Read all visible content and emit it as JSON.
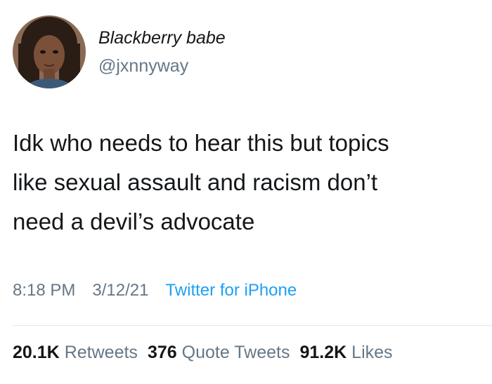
{
  "user": {
    "display_name": "Blackberry babe",
    "handle": "@jxnnyway"
  },
  "tweet": {
    "lines": [
      "Idk who needs to hear this but topics",
      "like sexual assault and racism don’t",
      "need a devil’s advocate"
    ],
    "time": "8:18 PM",
    "date": "3/12/21",
    "source": "Twitter for iPhone"
  },
  "stats": {
    "retweets_count": "20.1K",
    "retweets_label": "Retweets",
    "quotes_count": "376",
    "quotes_label": "Quote Tweets",
    "likes_count": "91.2K",
    "likes_label": "Likes"
  },
  "colors": {
    "text": "#14171a",
    "secondary": "#657786",
    "link": "#1da1f2",
    "divider": "#e1e8ed"
  }
}
